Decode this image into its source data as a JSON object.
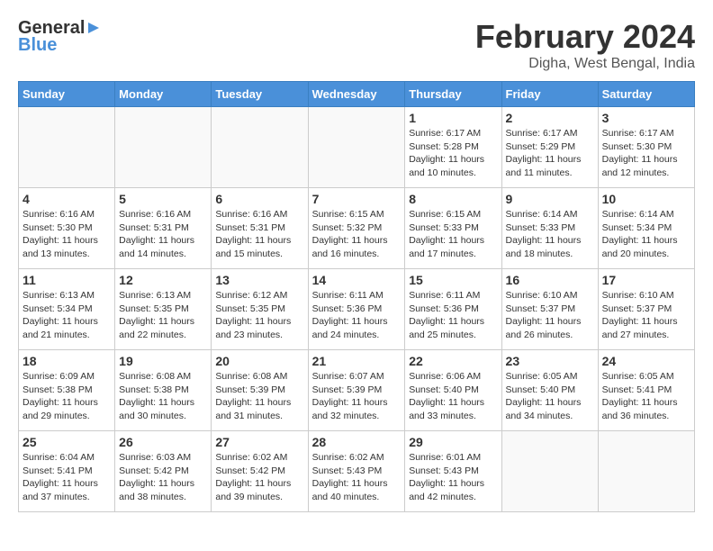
{
  "header": {
    "logo_general": "General",
    "logo_blue": "Blue",
    "month_title": "February 2024",
    "location": "Digha, West Bengal, India"
  },
  "days_of_week": [
    "Sunday",
    "Monday",
    "Tuesday",
    "Wednesday",
    "Thursday",
    "Friday",
    "Saturday"
  ],
  "weeks": [
    [
      {
        "day": "",
        "info": ""
      },
      {
        "day": "",
        "info": ""
      },
      {
        "day": "",
        "info": ""
      },
      {
        "day": "",
        "info": ""
      },
      {
        "day": "1",
        "info": "Sunrise: 6:17 AM\nSunset: 5:28 PM\nDaylight: 11 hours\nand 10 minutes."
      },
      {
        "day": "2",
        "info": "Sunrise: 6:17 AM\nSunset: 5:29 PM\nDaylight: 11 hours\nand 11 minutes."
      },
      {
        "day": "3",
        "info": "Sunrise: 6:17 AM\nSunset: 5:30 PM\nDaylight: 11 hours\nand 12 minutes."
      }
    ],
    [
      {
        "day": "4",
        "info": "Sunrise: 6:16 AM\nSunset: 5:30 PM\nDaylight: 11 hours\nand 13 minutes."
      },
      {
        "day": "5",
        "info": "Sunrise: 6:16 AM\nSunset: 5:31 PM\nDaylight: 11 hours\nand 14 minutes."
      },
      {
        "day": "6",
        "info": "Sunrise: 6:16 AM\nSunset: 5:31 PM\nDaylight: 11 hours\nand 15 minutes."
      },
      {
        "day": "7",
        "info": "Sunrise: 6:15 AM\nSunset: 5:32 PM\nDaylight: 11 hours\nand 16 minutes."
      },
      {
        "day": "8",
        "info": "Sunrise: 6:15 AM\nSunset: 5:33 PM\nDaylight: 11 hours\nand 17 minutes."
      },
      {
        "day": "9",
        "info": "Sunrise: 6:14 AM\nSunset: 5:33 PM\nDaylight: 11 hours\nand 18 minutes."
      },
      {
        "day": "10",
        "info": "Sunrise: 6:14 AM\nSunset: 5:34 PM\nDaylight: 11 hours\nand 20 minutes."
      }
    ],
    [
      {
        "day": "11",
        "info": "Sunrise: 6:13 AM\nSunset: 5:34 PM\nDaylight: 11 hours\nand 21 minutes."
      },
      {
        "day": "12",
        "info": "Sunrise: 6:13 AM\nSunset: 5:35 PM\nDaylight: 11 hours\nand 22 minutes."
      },
      {
        "day": "13",
        "info": "Sunrise: 6:12 AM\nSunset: 5:35 PM\nDaylight: 11 hours\nand 23 minutes."
      },
      {
        "day": "14",
        "info": "Sunrise: 6:11 AM\nSunset: 5:36 PM\nDaylight: 11 hours\nand 24 minutes."
      },
      {
        "day": "15",
        "info": "Sunrise: 6:11 AM\nSunset: 5:36 PM\nDaylight: 11 hours\nand 25 minutes."
      },
      {
        "day": "16",
        "info": "Sunrise: 6:10 AM\nSunset: 5:37 PM\nDaylight: 11 hours\nand 26 minutes."
      },
      {
        "day": "17",
        "info": "Sunrise: 6:10 AM\nSunset: 5:37 PM\nDaylight: 11 hours\nand 27 minutes."
      }
    ],
    [
      {
        "day": "18",
        "info": "Sunrise: 6:09 AM\nSunset: 5:38 PM\nDaylight: 11 hours\nand 29 minutes."
      },
      {
        "day": "19",
        "info": "Sunrise: 6:08 AM\nSunset: 5:38 PM\nDaylight: 11 hours\nand 30 minutes."
      },
      {
        "day": "20",
        "info": "Sunrise: 6:08 AM\nSunset: 5:39 PM\nDaylight: 11 hours\nand 31 minutes."
      },
      {
        "day": "21",
        "info": "Sunrise: 6:07 AM\nSunset: 5:39 PM\nDaylight: 11 hours\nand 32 minutes."
      },
      {
        "day": "22",
        "info": "Sunrise: 6:06 AM\nSunset: 5:40 PM\nDaylight: 11 hours\nand 33 minutes."
      },
      {
        "day": "23",
        "info": "Sunrise: 6:05 AM\nSunset: 5:40 PM\nDaylight: 11 hours\nand 34 minutes."
      },
      {
        "day": "24",
        "info": "Sunrise: 6:05 AM\nSunset: 5:41 PM\nDaylight: 11 hours\nand 36 minutes."
      }
    ],
    [
      {
        "day": "25",
        "info": "Sunrise: 6:04 AM\nSunset: 5:41 PM\nDaylight: 11 hours\nand 37 minutes."
      },
      {
        "day": "26",
        "info": "Sunrise: 6:03 AM\nSunset: 5:42 PM\nDaylight: 11 hours\nand 38 minutes."
      },
      {
        "day": "27",
        "info": "Sunrise: 6:02 AM\nSunset: 5:42 PM\nDaylight: 11 hours\nand 39 minutes."
      },
      {
        "day": "28",
        "info": "Sunrise: 6:02 AM\nSunset: 5:43 PM\nDaylight: 11 hours\nand 40 minutes."
      },
      {
        "day": "29",
        "info": "Sunrise: 6:01 AM\nSunset: 5:43 PM\nDaylight: 11 hours\nand 42 minutes."
      },
      {
        "day": "",
        "info": ""
      },
      {
        "day": "",
        "info": ""
      }
    ]
  ]
}
